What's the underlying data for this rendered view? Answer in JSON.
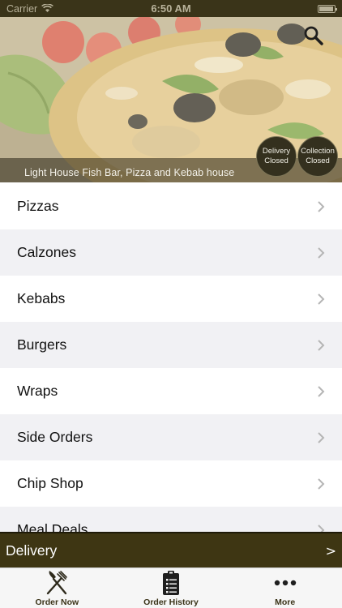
{
  "status_bar": {
    "carrier": "Carrier",
    "time": "6:50 AM"
  },
  "hero": {
    "caption": "Light House Fish Bar, Pizza and Kebab house",
    "delivery_status": [
      "Delivery",
      "Closed"
    ],
    "collection_status": [
      "Collection",
      "Closed"
    ]
  },
  "menu": {
    "items": [
      {
        "label": "Pizzas"
      },
      {
        "label": "Calzones"
      },
      {
        "label": "Kebabs"
      },
      {
        "label": "Burgers"
      },
      {
        "label": "Wraps"
      },
      {
        "label": "Side Orders"
      },
      {
        "label": "Chip Shop"
      },
      {
        "label": "Meal Deals"
      }
    ]
  },
  "delivery_bar": {
    "label": "Delivery",
    "arrow": ">"
  },
  "tab_bar": {
    "tabs": [
      {
        "label": "Order Now",
        "icon": "fork-knife-icon"
      },
      {
        "label": "Order History",
        "icon": "clipboard-list-icon"
      },
      {
        "label": "More",
        "icon": "more-dots-icon"
      }
    ]
  },
  "colors": {
    "brand_dark": "#3e3613",
    "status_bar": "#3a3419",
    "row_alt": "#f1f1f4"
  }
}
